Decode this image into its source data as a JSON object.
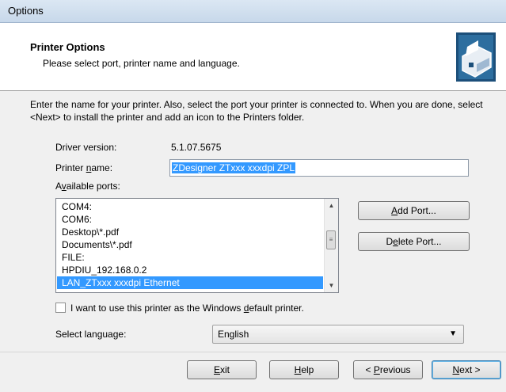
{
  "window": {
    "title": "Options"
  },
  "header": {
    "title": "Printer Options",
    "subtitle": "Please select port, printer name and language.",
    "icon": "printer-icon"
  },
  "intro_text": "Enter the name for your printer. Also, select the port your printer is connected to. When you are done, select <Next> to install the printer and add an icon to the Printers folder.",
  "driver": {
    "label": "Driver version:",
    "value": "5.1.07.5675"
  },
  "printer_name": {
    "label": "Printer name:",
    "value": "ZDesigner ZTxxx xxxdpi ZPL"
  },
  "ports": {
    "label": "Available ports:",
    "items": [
      "COM4:",
      "COM6:",
      "Desktop\\*.pdf",
      "Documents\\*.pdf",
      "FILE:",
      "HPDIU_192.168.0.2",
      "LAN_ZTxxx xxxdpi Ethernet"
    ],
    "selected_index": 6
  },
  "buttons": {
    "add_port": "Add Port...",
    "delete_port": "Delete Port...",
    "exit": "Exit",
    "help": "Help",
    "previous": "< Previous",
    "next": "Next >"
  },
  "default_printer_checkbox": {
    "label": "I want to use this printer as the Windows default printer.",
    "checked": false
  },
  "language": {
    "label": "Select language:",
    "value": "English"
  }
}
